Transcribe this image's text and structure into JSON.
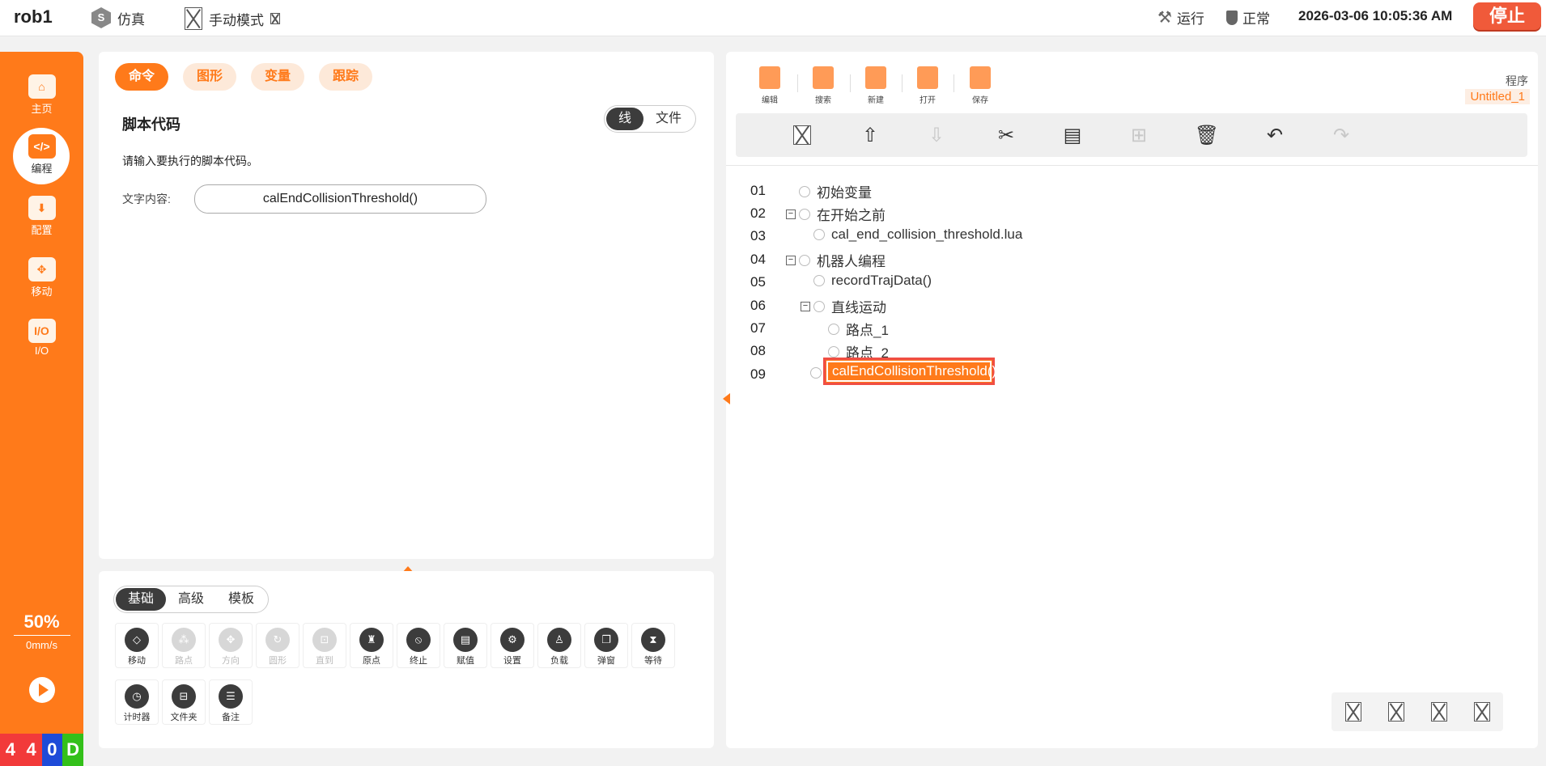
{
  "topbar": {
    "robot": "rob1",
    "sim_label": "仿真",
    "mode_label": "手动模式",
    "run_label": "运行",
    "state_label": "正常",
    "datetime": "2026-03-06 10:05:36 AM",
    "stop_label": "停止"
  },
  "sidebar": {
    "items": [
      {
        "label": "主页",
        "icon": "home-icon"
      },
      {
        "label": "编程",
        "icon": "code-icon"
      },
      {
        "label": "配置",
        "icon": "config-icon"
      },
      {
        "label": "移动",
        "icon": "move-icon"
      },
      {
        "label": "I/O",
        "icon": "io-icon"
      }
    ],
    "speed_pct": "50%",
    "speed_val": "0mm/s",
    "digits": [
      "4",
      "4",
      "0",
      "D"
    ],
    "digit_colors": [
      "#f23a3a",
      "#f23a3a",
      "#1e4bd8",
      "#33c01a"
    ]
  },
  "left_top": {
    "tabs": [
      "命令",
      "图形",
      "变量",
      "跟踪"
    ],
    "title": "脚本代码",
    "seg": [
      "线",
      "文件"
    ],
    "hint": "请输入要执行的脚本代码。",
    "field_label": "文字内容:",
    "field_value": "calEndCollisionThreshold()"
  },
  "left_bottom": {
    "seg": [
      "基础",
      "高级",
      "模板"
    ],
    "commands": [
      {
        "label": "移动",
        "enabled": true,
        "glyph": "◇"
      },
      {
        "label": "路点",
        "enabled": false,
        "glyph": "⁂"
      },
      {
        "label": "方向",
        "enabled": false,
        "glyph": "✥"
      },
      {
        "label": "圆形",
        "enabled": false,
        "glyph": "↻"
      },
      {
        "label": "直到",
        "enabled": false,
        "glyph": "⊡"
      },
      {
        "label": "原点",
        "enabled": true,
        "glyph": "♜"
      },
      {
        "label": "终止",
        "enabled": true,
        "glyph": "⦸"
      },
      {
        "label": "赋值",
        "enabled": true,
        "glyph": "▤"
      },
      {
        "label": "设置",
        "enabled": true,
        "glyph": "⚙"
      },
      {
        "label": "负载",
        "enabled": true,
        "glyph": "♙"
      },
      {
        "label": "弹窗",
        "enabled": true,
        "glyph": "❐"
      },
      {
        "label": "等待",
        "enabled": true,
        "glyph": "⧗"
      },
      {
        "label": "计时器",
        "enabled": true,
        "glyph": "◷"
      },
      {
        "label": "文件夹",
        "enabled": true,
        "glyph": "⊟"
      },
      {
        "label": "备注",
        "enabled": true,
        "glyph": "☰"
      }
    ]
  },
  "right": {
    "toolbar": [
      "编辑",
      "搜索",
      "新建",
      "打开",
      "保存"
    ],
    "program_label": "程序",
    "program_name": "Untitled_1",
    "actions": [
      {
        "icon": "broken-image-icon",
        "glyph": "",
        "enabled": true
      },
      {
        "icon": "move-up-icon",
        "glyph": "⇧",
        "enabled": true
      },
      {
        "icon": "move-down-icon",
        "glyph": "⇩",
        "enabled": false
      },
      {
        "icon": "cut-icon",
        "glyph": "✂",
        "enabled": true
      },
      {
        "icon": "clipboard-icon",
        "glyph": "▤",
        "enabled": true
      },
      {
        "icon": "insert-icon",
        "glyph": "⊞",
        "enabled": false
      },
      {
        "icon": "delete-icon",
        "glyph": "🗑",
        "enabled": true
      },
      {
        "icon": "undo-icon",
        "glyph": "↶",
        "enabled": true
      },
      {
        "icon": "redo-icon",
        "glyph": "↷",
        "enabled": false
      }
    ],
    "lines": [
      "01",
      "02",
      "03",
      "04",
      "05",
      "06",
      "07",
      "08",
      "09"
    ],
    "tree": [
      {
        "text": "初始变量",
        "level": 0,
        "expander": false
      },
      {
        "text": "在开始之前",
        "level": 0,
        "expander": true
      },
      {
        "text": "cal_end_collision_threshold.lua",
        "level": 1,
        "expander": false
      },
      {
        "text": "机器人编程",
        "level": 0,
        "expander": true
      },
      {
        "text": "recordTrajData()",
        "level": 1,
        "expander": false
      },
      {
        "text": "直线运动",
        "level": 1,
        "expander": true
      },
      {
        "text": "路点_1",
        "level": 2,
        "expander": false
      },
      {
        "text": "路点_2",
        "level": 2,
        "expander": false
      }
    ],
    "selected": "calEndCollisionThreshold()"
  }
}
